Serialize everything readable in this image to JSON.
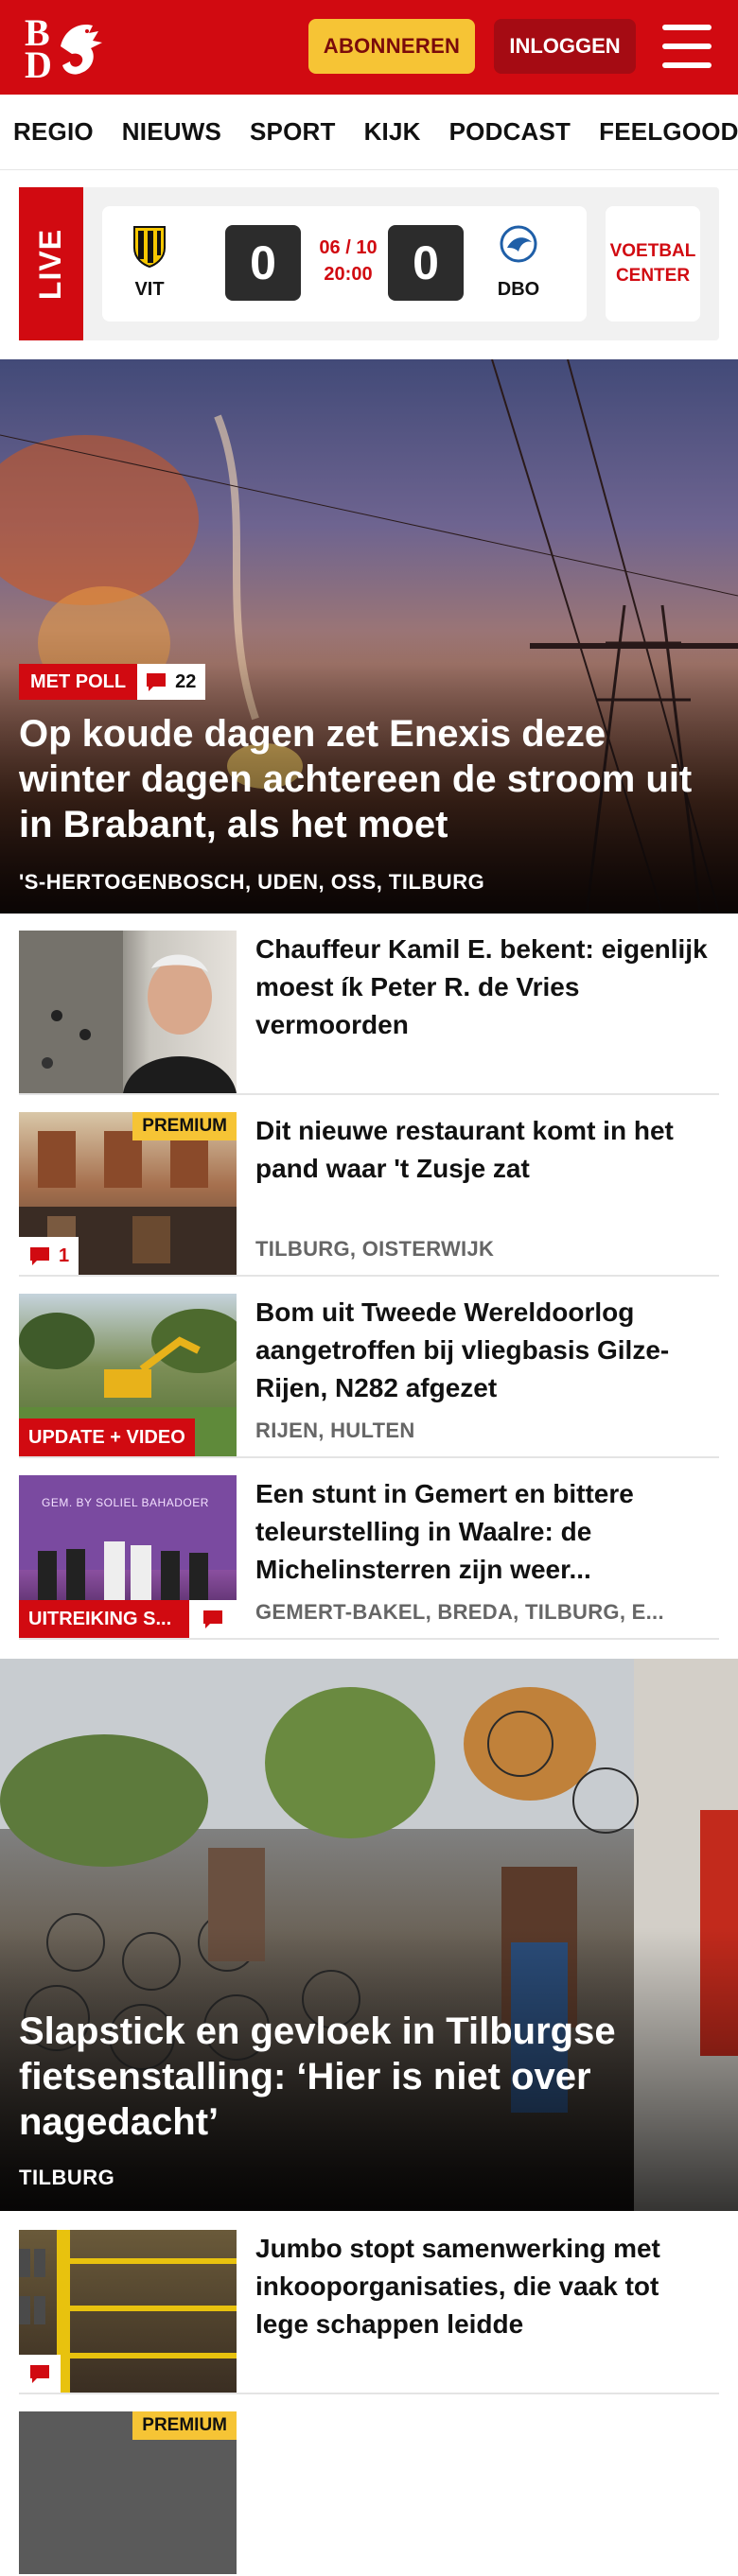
{
  "header": {
    "logo_letters": [
      "B",
      "D"
    ],
    "subscribe_label": "ABONNEREN",
    "login_label": "INLOGGEN",
    "brand_color": "#d10a11",
    "accent_color": "#f6c435"
  },
  "nav": {
    "items": [
      "REGIO",
      "NIEUWS",
      "SPORT",
      "KIJK",
      "PODCAST",
      "FEELGOOD"
    ]
  },
  "live": {
    "tag": "LIVE",
    "home_team": "VIT",
    "home_score": "0",
    "away_team": "DBO",
    "away_score": "0",
    "date": "06 / 10",
    "time": "20:00",
    "voetbal_center_line1": "VOETBAL",
    "voetbal_center_line2": "CENTER"
  },
  "hero1": {
    "badge": "MET POLL",
    "comments": "22",
    "title": "Op koude dagen zet Enexis deze winter dagen achtereen de stroom uit in Brabant, als het moet",
    "location": "'S-HERTOGENBOSCH, UDEN, OSS, TILBURG"
  },
  "articles": [
    {
      "title": "Chauffeur Kamil E. bekent: eigenlijk moest ík Peter R. de Vries vermoorden",
      "location": ""
    },
    {
      "title": "Dit nieuwe restaurant komt in het pand waar 't Zusje zat",
      "location": "TILBURG, OISTERWIJK",
      "premium": "PREMIUM",
      "comments": "1"
    },
    {
      "title": "Bom uit Tweede Wereldoorlog aangetroffen bij vliegbasis Gilze-Rijen, N282 afgezet",
      "location": "RIJEN, HULTEN",
      "label": "UPDATE + VIDEO"
    },
    {
      "title": "Een stunt in Gemert en bittere teleurstelling in Waalre: de Michelinsterren zijn weer...",
      "location": "GEMERT-BAKEL, BREDA, TILBURG, E...",
      "label": "UITREIKING S...",
      "thumb_text": "GEM. BY SOLIEL BAHADOER"
    }
  ],
  "hero2": {
    "title": "Slapstick en gevloek in Tilburgse fietsenstalling: ‘Hier is niet over nagedacht’",
    "location": "TILBURG"
  },
  "article5": {
    "title": "Jumbo stopt samenwerking met inkooporganisaties, die vaak tot lege schappen leidde"
  },
  "article6": {
    "premium": "PREMIUM"
  }
}
